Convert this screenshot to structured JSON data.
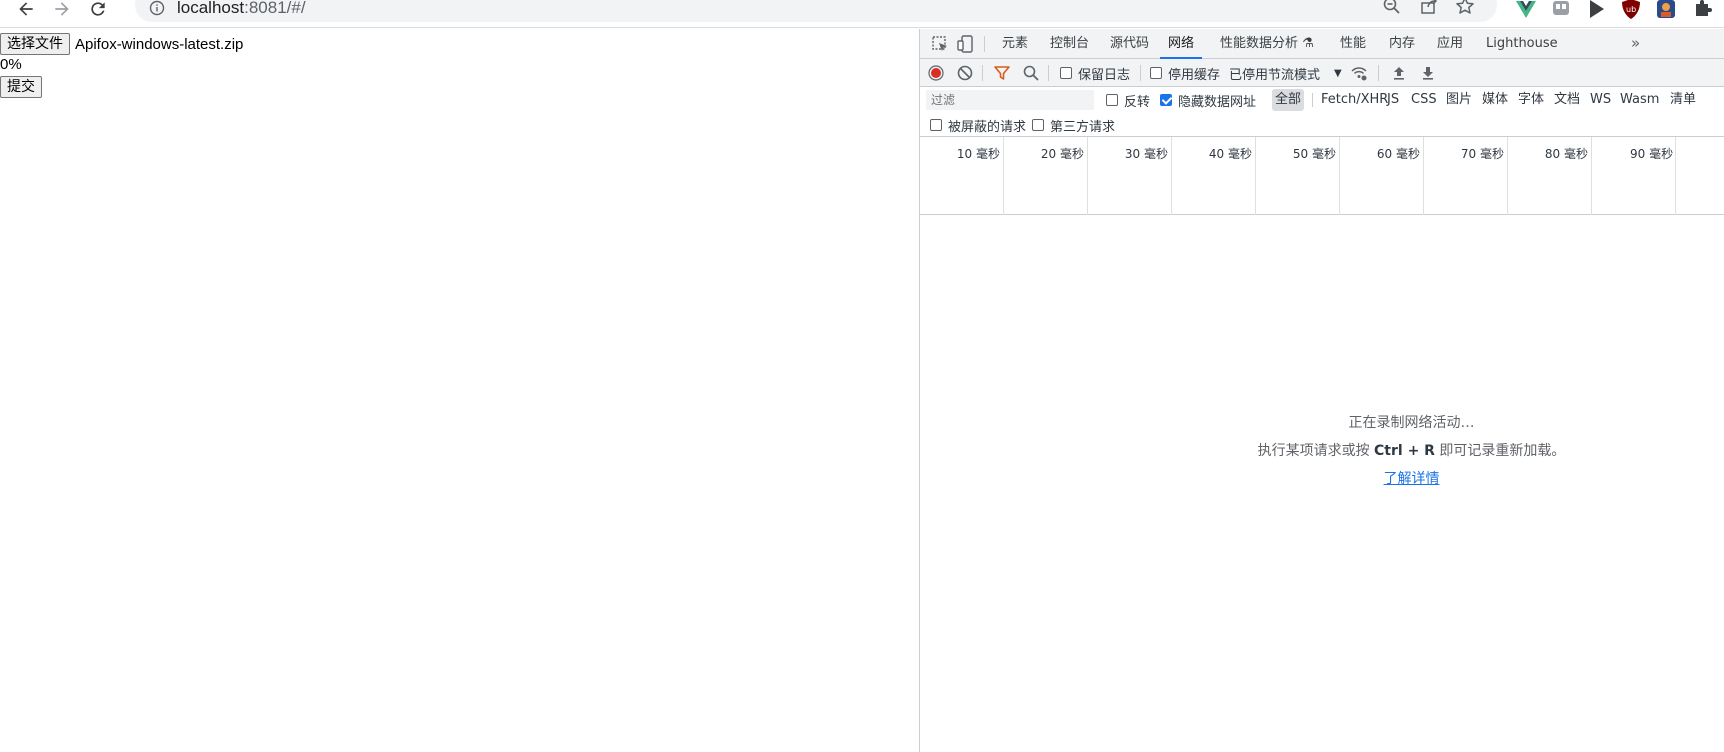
{
  "browser": {
    "url_host": "localhost",
    "url_rest": ":8081/#/",
    "icons": [
      "back-icon",
      "forward-icon",
      "reload-icon",
      "info-icon",
      "zoom-out-icon",
      "share-icon",
      "bookmark-star-icon",
      "vue-devtools-icon",
      "extension-icon",
      "play-icon",
      "ublock-icon",
      "profile-icon",
      "puzzle-icon"
    ]
  },
  "page": {
    "choose_file_label": "选择文件",
    "file_name": "Apifox-windows-latest.zip",
    "progress_text": "0%",
    "submit_label": "提交"
  },
  "devtools": {
    "tabs": [
      {
        "label": "元素",
        "active": false
      },
      {
        "label": "控制台",
        "active": false
      },
      {
        "label": "源代码",
        "active": false
      },
      {
        "label": "网络",
        "active": true
      },
      {
        "label": "性能数据分析",
        "active": false
      },
      {
        "label": "性能",
        "active": false
      },
      {
        "label": "内存",
        "active": false
      },
      {
        "label": "应用",
        "active": false
      },
      {
        "label": "Lighthouse",
        "active": false
      }
    ],
    "more_tabs": "»",
    "toolbar": {
      "preserve_log": "保留日志",
      "disable_cache": "停用缓存",
      "throttling": "已停用节流模式"
    },
    "filter": {
      "placeholder": "过滤",
      "invert": "反转",
      "hide_data_urls": "隐藏数据网址",
      "types": [
        "全部",
        "Fetch/XHR",
        "JS",
        "CSS",
        "图片",
        "媒体",
        "字体",
        "文档",
        "WS",
        "Wasm",
        "清单"
      ],
      "blocked_requests": "被屏蔽的请求",
      "third_party": "第三方请求"
    },
    "timeline_ticks": [
      "10 毫秒",
      "20 毫秒",
      "30 毫秒",
      "40 毫秒",
      "50 毫秒",
      "60 毫秒",
      "70 毫秒",
      "80 毫秒",
      "90 毫秒"
    ],
    "empty": {
      "title": "正在录制网络活动…",
      "desc_prefix": "执行某项请求或按",
      "shortcut": "Ctrl + R",
      "desc_suffix": "即可记录重新加载。",
      "link": "了解详情"
    }
  },
  "colors": {
    "accent": "#1a73e8",
    "record": "#d93025",
    "filter_icon": "#d95c1a"
  }
}
